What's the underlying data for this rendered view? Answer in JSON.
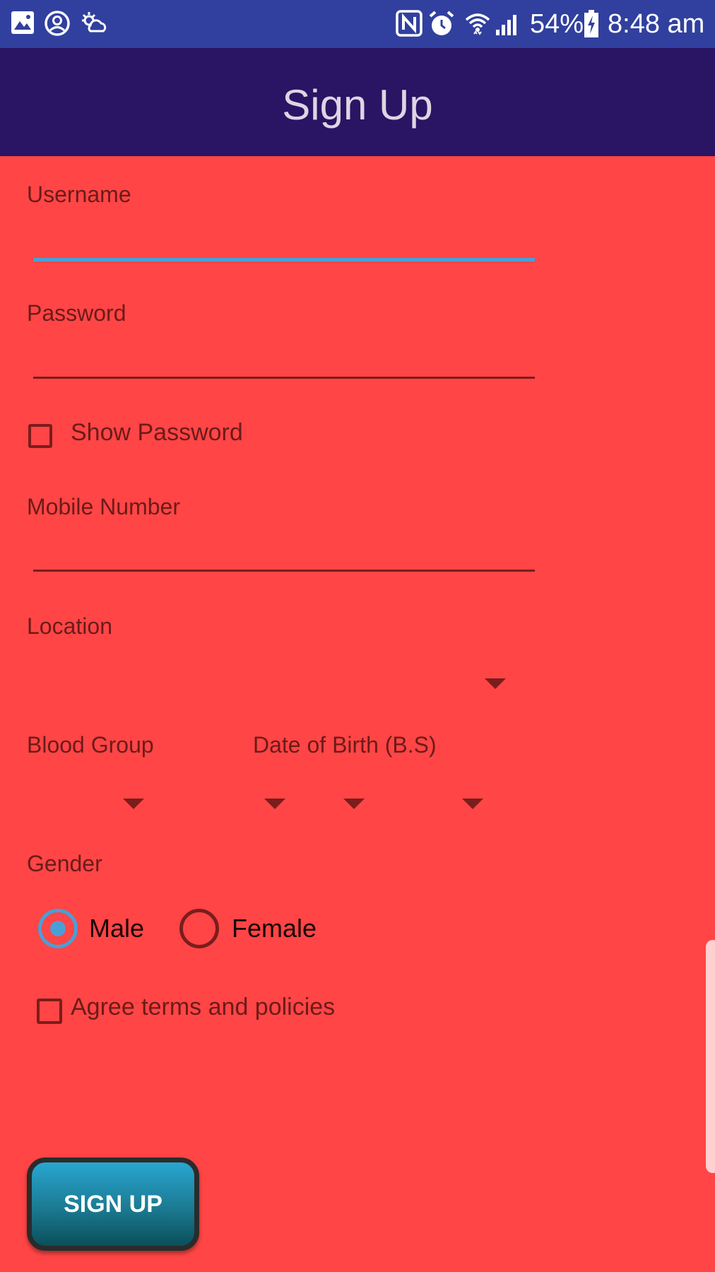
{
  "status_bar": {
    "battery": "54%",
    "time": "8:48 am",
    "icons": [
      "gallery-icon",
      "account-circle-icon",
      "weather-icon",
      "nfc-icon",
      "alarm-icon",
      "wifi-icon",
      "signal-icon",
      "battery-charging-icon"
    ]
  },
  "app_bar": {
    "title": "Sign Up"
  },
  "form": {
    "username": {
      "label": "Username",
      "value": ""
    },
    "password": {
      "label": "Password",
      "value": ""
    },
    "show_password": {
      "label": "Show Password",
      "checked": false
    },
    "mobile": {
      "label": "Mobile Number",
      "value": ""
    },
    "location": {
      "label": "Location",
      "value": ""
    },
    "blood_group": {
      "label": "Blood Group",
      "value": ""
    },
    "dob": {
      "label": "Date of Birth (B.S)",
      "year": "",
      "month": "",
      "day": ""
    },
    "gender": {
      "label": "Gender",
      "options": [
        "Male",
        "Female"
      ],
      "selected": "Male"
    },
    "agree": {
      "label": "Agree terms and policies",
      "checked": false
    }
  },
  "signup_button": {
    "label": "SIGN UP"
  },
  "colors": {
    "background": "#ff4545",
    "status_bar": "#31409e",
    "app_bar": "#2a1464",
    "accent": "#4a9fd6",
    "text_dark": "#6b1b1b",
    "button_top": "#29a6d1",
    "button_bottom": "#0a4f5a"
  }
}
